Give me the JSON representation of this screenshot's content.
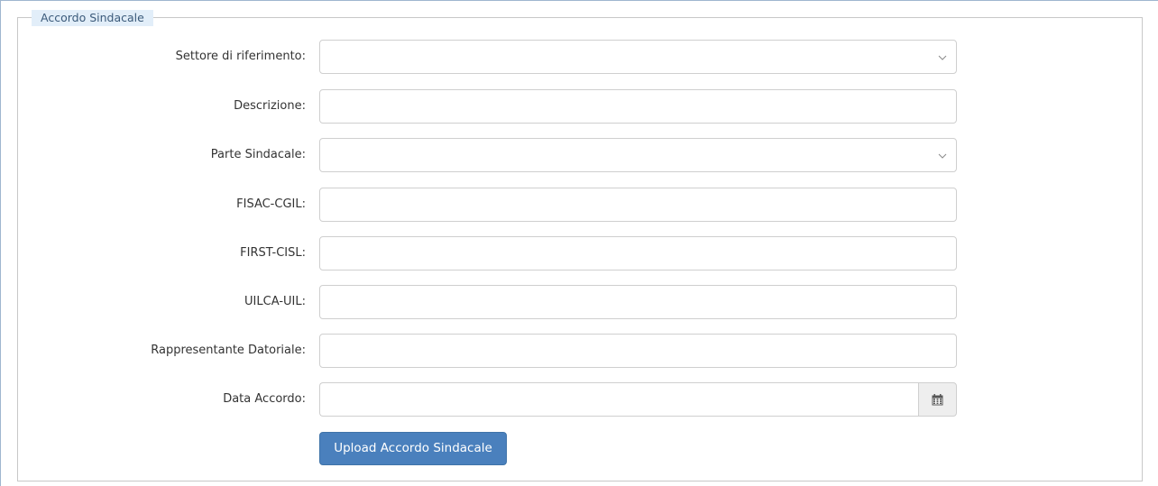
{
  "form": {
    "legend": "Accordo Sindacale",
    "fields": [
      {
        "label": "Settore di riferimento:",
        "type": "select",
        "value": ""
      },
      {
        "label": "Descrizione:",
        "type": "text",
        "value": ""
      },
      {
        "label": "Parte Sindacale:",
        "type": "select",
        "value": ""
      },
      {
        "label": "FISAC-CGIL:",
        "type": "text",
        "value": ""
      },
      {
        "label": "FIRST-CISL:",
        "type": "text",
        "value": ""
      },
      {
        "label": "UILCA-UIL:",
        "type": "text",
        "value": ""
      },
      {
        "label": "Rappresentante Datoriale:",
        "type": "text",
        "value": ""
      },
      {
        "label": "Data Accordo:",
        "type": "date",
        "value": ""
      }
    ],
    "upload_label": "Upload Accordo Sindacale",
    "icons": {
      "select_arrow": "chevron-down-icon",
      "date_picker": "calendar-icon"
    }
  },
  "colors": {
    "legend_bg": "#e2eef9",
    "legend_text": "#3b5a7a",
    "button_bg": "#4a80bd",
    "button_text": "#ffffff",
    "input_border": "#cfcfcf",
    "addon_bg": "#eeeeee"
  }
}
